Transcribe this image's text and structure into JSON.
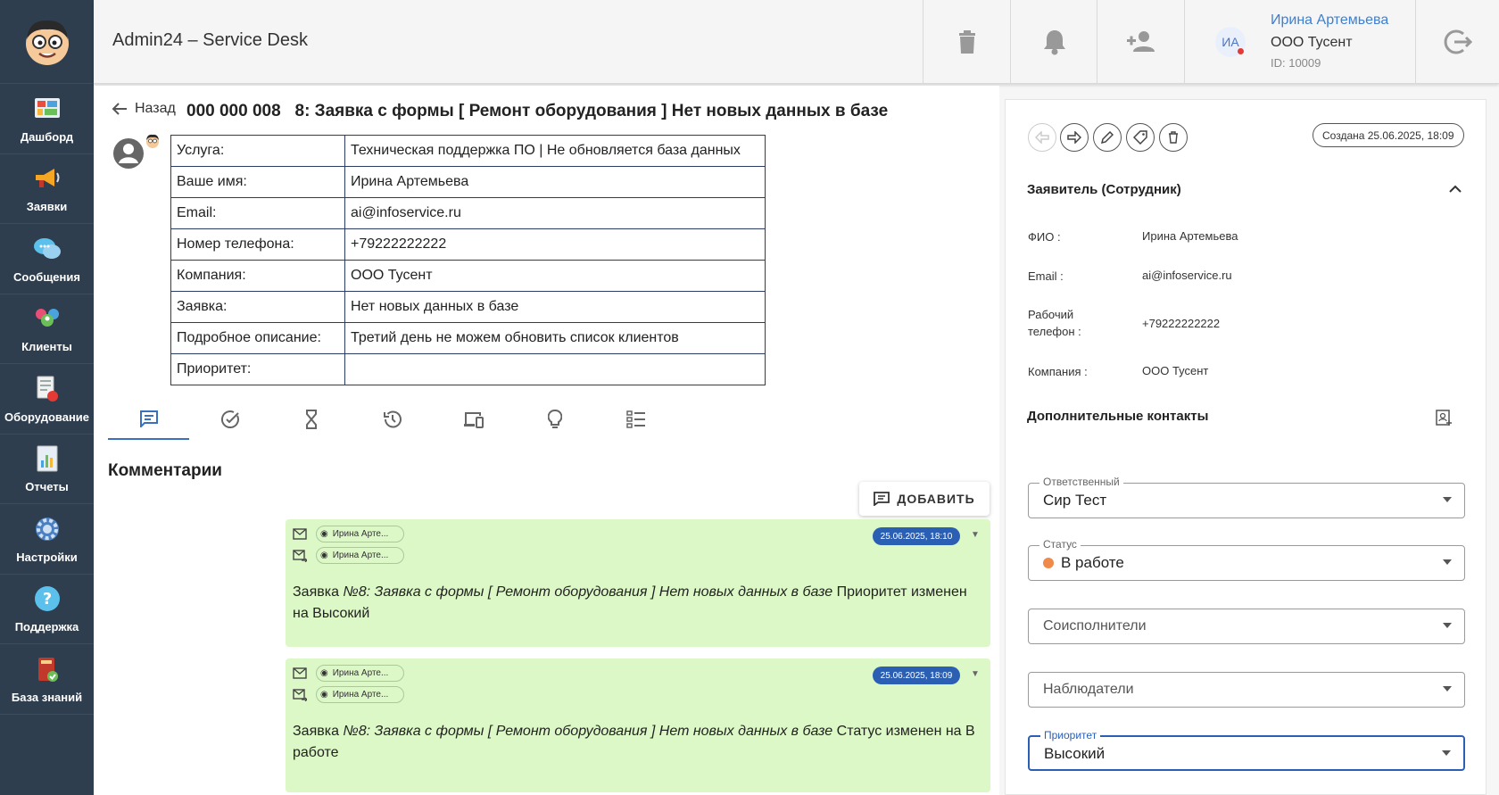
{
  "app": {
    "title": "Admin24 – Service Desk"
  },
  "sidebar": {
    "items": [
      {
        "label": "Дашборд",
        "icon": "dashboard-icon"
      },
      {
        "label": "Заявки",
        "icon": "megaphone-icon"
      },
      {
        "label": "Сообщения",
        "icon": "chat-bubbles-icon"
      },
      {
        "label": "Клиенты",
        "icon": "clients-icon"
      },
      {
        "label": "Оборудование",
        "icon": "equipment-icon"
      },
      {
        "label": "Отчеты",
        "icon": "reports-icon"
      },
      {
        "label": "Настройки",
        "icon": "gear-icon"
      },
      {
        "label": "Поддержка",
        "icon": "help-icon"
      },
      {
        "label": "База знаний",
        "icon": "knowledge-book-icon"
      }
    ]
  },
  "header": {
    "user": {
      "initials": "ИА",
      "name": "Ирина Артемьева",
      "company": "ООО Тусент",
      "id_text": "ID: 10009"
    }
  },
  "ticket": {
    "back_label": "Назад",
    "title": "000 000 008   8: Заявка с формы [ Ремонт оборудования ] Нет новых данных в базе",
    "fields": [
      {
        "key": "Услуга:",
        "value": "Техническая поддержка ПО | Не обновляется база данных"
      },
      {
        "key": "Ваше имя:",
        "value": "Ирина Артемьева"
      },
      {
        "key": "Email:",
        "value": "ai@infoservice.ru"
      },
      {
        "key": "Номер телефона:",
        "value": "+79222222222"
      },
      {
        "key": "Компания:",
        "value": "ООО Тусент"
      },
      {
        "key": "Заявка:",
        "value": "Нет новых данных в базе"
      },
      {
        "key": "Подробное описание:",
        "value": "Третий день не можем обновить список клиентов"
      },
      {
        "key": "Приоритет:",
        "value": ""
      }
    ]
  },
  "tabs": [
    "comments-tab-icon",
    "check-circle-icon",
    "hourglass-icon",
    "history-icon",
    "devices-icon",
    "lightbulb-icon",
    "checklist-icon"
  ],
  "comments": {
    "title": "Комментарии",
    "add_label": "ДОБАВИТЬ",
    "items": [
      {
        "from": "Ирина Арте...",
        "to": "Ирина Арте...",
        "date": "25.06.2025, 18:10",
        "prefix": "Заявка ",
        "italic": "№8: Заявка с формы [ Ремонт оборудования ] Нет новых данных в базе",
        "suffix": " Приоритет изменен на Высокий"
      },
      {
        "from": "Ирина Арте...",
        "to": "Ирина Арте...",
        "date": "25.06.2025, 18:09",
        "prefix": "Заявка ",
        "italic": "№8: Заявка с формы [ Ремонт оборудования ] Нет новых данных в базе",
        "suffix": " Статус изменен на В работе"
      }
    ]
  },
  "panel": {
    "created": "Создана 25.06.2025, 18:09",
    "requester_title": "Заявитель (Сотрудник)",
    "fields": [
      {
        "label": "ФИО :",
        "value": "Ирина Артемьева"
      },
      {
        "label": "Email :",
        "value": "ai@infoservice.ru"
      },
      {
        "label": "Рабочий телефон :",
        "value": "+79222222222"
      },
      {
        "label": "Компания :",
        "value": "ООО Тусент"
      }
    ],
    "extra_contacts_title": "Дополнительные контакты",
    "responsible": {
      "legend": "Ответственный",
      "value": "Сир Тест"
    },
    "status": {
      "legend": "Статус",
      "value": "В работе",
      "color": "#f08a4b"
    },
    "coexecutors": {
      "placeholder": "Соисполнители"
    },
    "observers": {
      "placeholder": "Наблюдатели"
    },
    "priority": {
      "legend": "Приоритет",
      "value": "Высокий"
    }
  },
  "colors": {
    "sidebar": "#2e3e4e",
    "accent": "#2b5fb4",
    "comment_bg": "#dcf8c6",
    "link": "#3f7fcf"
  }
}
